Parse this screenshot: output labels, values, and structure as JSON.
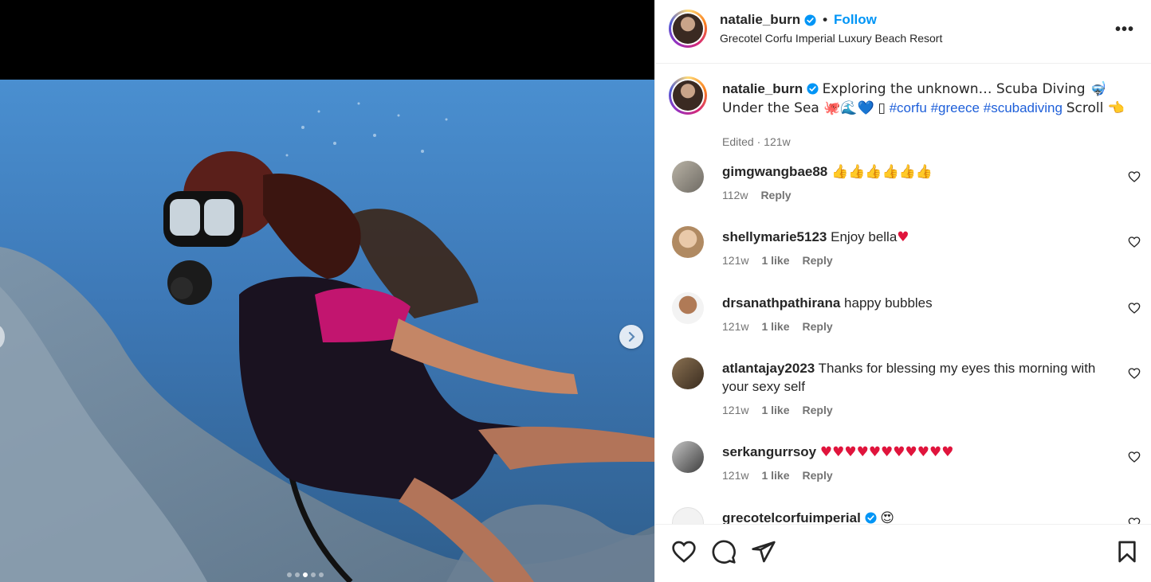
{
  "post": {
    "username": "natalie_burn",
    "follow_label": "Follow",
    "separator": "•",
    "location": "Grecotel Corfu Imperial Luxury Beach Resort",
    "more_label": "•••"
  },
  "caption": {
    "username": "natalie_burn",
    "text_1": "Exploring the unknown… Scuba Diving 🤿 Under the Sea 🐙🌊💙",
    "box_glyph": "▯",
    "hashtags": [
      "#corfu",
      "#greece",
      "#scubadiving"
    ],
    "text_2": "Scroll 👈",
    "edited": "Edited",
    "time": "121w",
    "dot": "·"
  },
  "comments": [
    {
      "username": "gimgwangbae88",
      "text": "👍👍👍👍👍👍",
      "time": "112w",
      "likes": "",
      "reply": "Reply",
      "verified": false
    },
    {
      "username": "shellymarie5123",
      "text": "Enjoy bella",
      "heart_emoji": "♥",
      "time": "121w",
      "likes": "1 like",
      "reply": "Reply",
      "verified": false
    },
    {
      "username": "drsanathpathirana",
      "text": "happy bubbles",
      "time": "121w",
      "likes": "1 like",
      "reply": "Reply",
      "verified": false
    },
    {
      "username": "atlantajay2023",
      "text": "Thanks for blessing my eyes this morning with your sexy self",
      "time": "121w",
      "likes": "1 like",
      "reply": "Reply",
      "verified": false
    },
    {
      "username": "serkangurrsoy",
      "text": "♥♥♥♥♥♥♥♥♥♥♥",
      "time": "121w",
      "likes": "1 like",
      "reply": "Reply",
      "verified": false
    },
    {
      "username": "grecotelcorfuimperial",
      "text": "😍",
      "time": "",
      "likes": "",
      "reply": "",
      "verified": true
    }
  ],
  "carousel": {
    "total": 5,
    "active_index": 2
  },
  "colors": {
    "accent": "#0095f6",
    "hashtag": "#1e5fd9",
    "muted": "#737373",
    "heart_red": "#e0143c"
  }
}
